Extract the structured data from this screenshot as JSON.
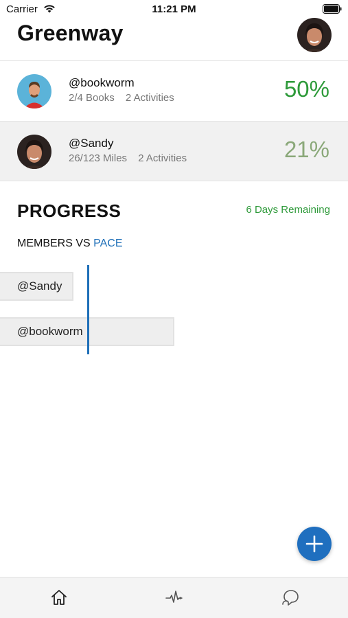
{
  "status_bar": {
    "carrier": "Carrier",
    "time": "11:21 PM",
    "icons": [
      "wifi-icon",
      "battery-icon"
    ]
  },
  "header": {
    "title": "Greenway",
    "avatar": "user-avatar"
  },
  "members": [
    {
      "name": "@bookworm",
      "progress": "2/4 Books",
      "activities": "2 Activities",
      "percent": "50%",
      "percent_color": "#2e9a3a"
    },
    {
      "name": "@Sandy",
      "progress": "26/123 Miles",
      "activities": "2 Activities",
      "percent": "21%",
      "percent_color": "#8aa879"
    }
  ],
  "progress": {
    "title": "PROGRESS",
    "remaining": "6 Days Remaining",
    "subtitle_prefix": "MEMBERS VS ",
    "subtitle_highlight": "PACE"
  },
  "chart_data": {
    "type": "bar",
    "orientation": "horizontal",
    "categories": [
      "@Sandy",
      "@bookworm"
    ],
    "series": [
      {
        "values": [
          0.21,
          0.5
        ]
      }
    ],
    "pace_line": true
  },
  "fab": {
    "icon": "plus-icon"
  },
  "tabbar": {
    "tabs": [
      {
        "icon": "home-icon"
      },
      {
        "icon": "activity-icon"
      },
      {
        "icon": "chat-icon"
      }
    ]
  },
  "colors": {
    "accent_green": "#2e9a3a",
    "accent_olive": "#8aa879",
    "accent_blue": "#1e6fb8",
    "fab_blue": "#1f6fbf"
  }
}
